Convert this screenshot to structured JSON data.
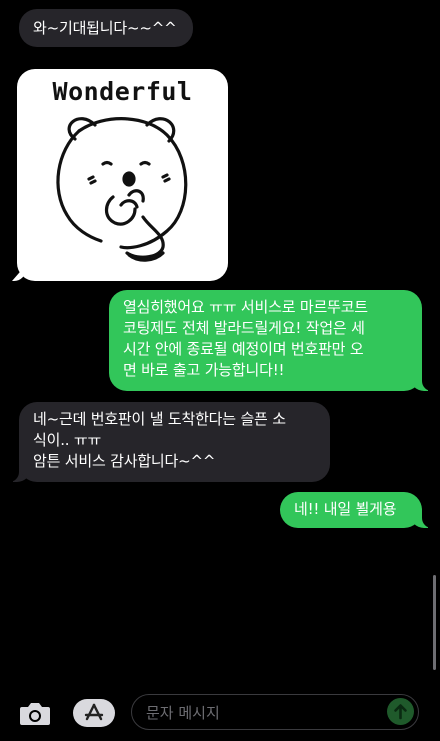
{
  "messages": [
    {
      "direction": "incoming",
      "text": "와~기대됩니다~~^^"
    },
    {
      "direction": "incoming",
      "type": "sticker",
      "sticker_text": "Wonderful"
    },
    {
      "direction": "outgoing",
      "lines": [
        "열심히했어요 ㅠㅠ 서비스로 마르뚜코트",
        "코팅제도 전체 발라드릴게요! 작업은 세",
        "시간 안에 종료될 예정이며 번호판만 오",
        "면 바로 출고 가능합니다!!"
      ]
    },
    {
      "direction": "incoming",
      "lines": [
        "네~근데 번호판이 낼 도착한다는 슬픈 소",
        "식이.. ㅠㅠ",
        "암튼 서비스 감사합니다~^^"
      ]
    },
    {
      "direction": "outgoing",
      "text": "네!! 내일 뵐게용"
    }
  ],
  "composer": {
    "placeholder": "문자 메시지",
    "camera_icon": "camera-icon",
    "apps_icon": "app-store-icon",
    "send_icon": "send-arrow-icon"
  },
  "colors": {
    "background": "#000000",
    "incoming_bubble": "#26252a",
    "outgoing_bubble": "#32c65a",
    "send_button": "#1f5a2b"
  }
}
